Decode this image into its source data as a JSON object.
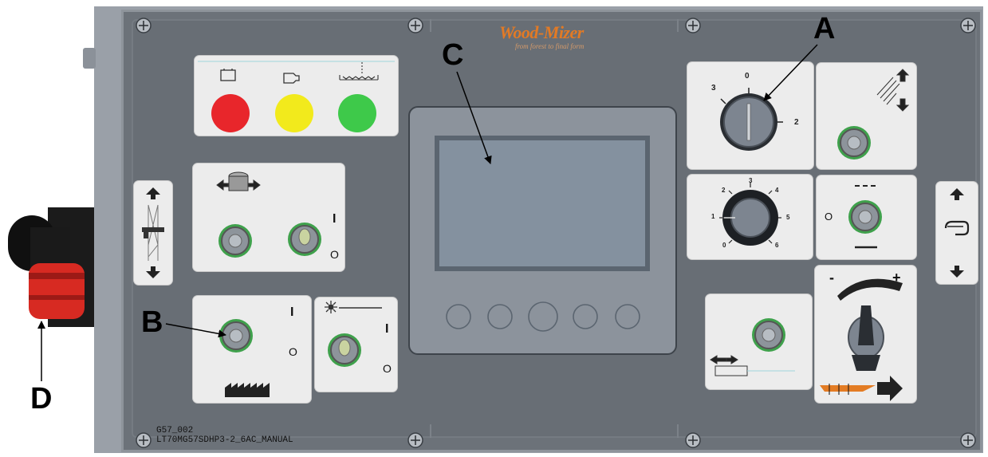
{
  "brand": {
    "name": "Wood-Mizer",
    "slogan": "from forest to final form"
  },
  "callouts": {
    "a": "A",
    "b": "B",
    "c": "C",
    "d": "D"
  },
  "drawing_code": {
    "line1": "G57_002",
    "line2": "LT70MG57SDHP3-2_6AC_MANUAL"
  },
  "key_switch_positions": {
    "left": "3",
    "top": "0",
    "right": "2"
  },
  "speed_dial_numbers": [
    "0",
    "1",
    "2",
    "3",
    "4",
    "5",
    "6"
  ],
  "switch_marks": {
    "on": "I",
    "off": "O"
  },
  "indicator_lights": [
    {
      "icon": "battery-icon",
      "color": "#e8262b"
    },
    {
      "icon": "engine-icon",
      "color": "#f2ea1c"
    },
    {
      "icon": "coolant-icon",
      "color": "#3ec94a"
    }
  ],
  "adjust_signs": {
    "minus": "-",
    "plus": "+"
  }
}
